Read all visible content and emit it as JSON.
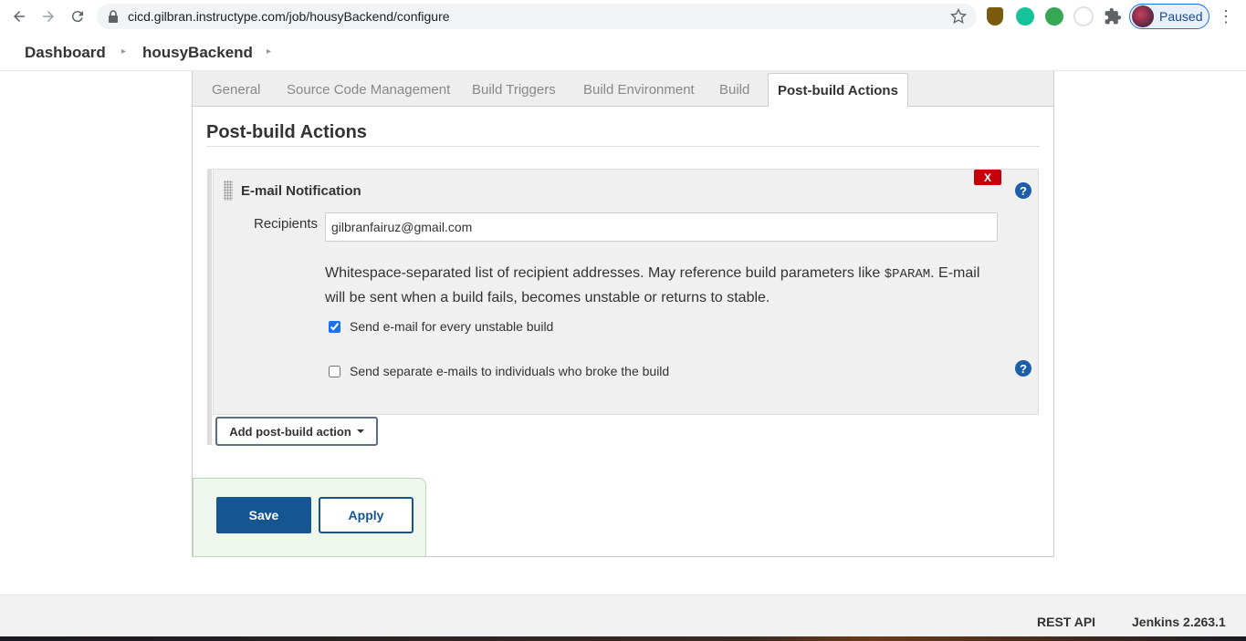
{
  "browser": {
    "url": "cicd.gilbran.instructype.com/job/housyBackend/configure",
    "profile_label": "Paused",
    "icons": [
      "back-icon",
      "forward-icon",
      "reload-icon",
      "lock-icon",
      "star-icon",
      "shield-extension-icon",
      "grammarly-extension-icon",
      "owl-extension-icon",
      "bike-extension-icon",
      "puzzle-extension-icon",
      "kebab-menu-icon"
    ]
  },
  "breadcrumb": {
    "dashboard": "Dashboard",
    "job": "housyBackend",
    "sep": "▸"
  },
  "tabs": [
    {
      "label": "General"
    },
    {
      "label": "Source Code Management"
    },
    {
      "label": "Build Triggers"
    },
    {
      "label": "Build Environment"
    },
    {
      "label": "Build"
    },
    {
      "label": "Post-build Actions",
      "active": true
    }
  ],
  "section": {
    "title": "Post-build Actions"
  },
  "email": {
    "title": "E-mail Notification",
    "delete_label": "X",
    "help_label": "?",
    "recipients_label": "Recipients",
    "recipients_value": "gilbranfairuz@gmail.com",
    "desc_before": "Whitespace-separated list of recipient addresses. May reference build parameters like ",
    "desc_code": "$PARAM",
    "desc_after": ". E-mail will be sent when a build fails, becomes unstable or returns to stable.",
    "unstable_label": "Send e-mail for every unstable build",
    "unstable_checked": true,
    "separate_label": "Send separate e-mails to individuals who broke the build",
    "separate_checked": false
  },
  "add_action_label": "Add post-build action",
  "buttons": {
    "save": "Save",
    "apply": "Apply"
  },
  "footer": {
    "rest_api": "REST API",
    "version": "Jenkins 2.263.1"
  },
  "colors": {
    "primary": "#145592",
    "danger": "#c4000a",
    "help": "#1c5fa8"
  }
}
